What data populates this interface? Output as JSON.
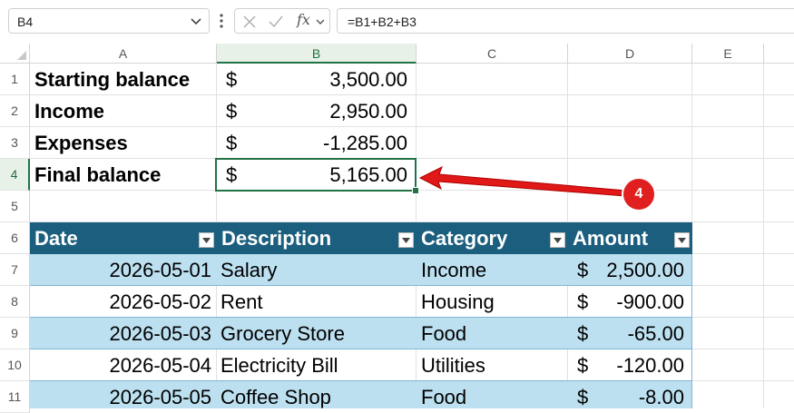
{
  "formula_bar": {
    "name_box": "B4",
    "formula": "=B1+B2+B3",
    "icons": [
      "chevron-down-icon",
      "more-vertical-icon",
      "cancel-icon",
      "enter-check-icon",
      "insert-function-icon",
      "expand-chevron-icon"
    ]
  },
  "columns": [
    "A",
    "B",
    "C",
    "D",
    "E"
  ],
  "rows": [
    "1",
    "2",
    "3",
    "4",
    "5",
    "6",
    "7",
    "8",
    "9",
    "10",
    "11"
  ],
  "summary": [
    {
      "label": "Starting balance",
      "currency": "$",
      "value": "3,500.00"
    },
    {
      "label": "Income",
      "currency": "$",
      "value": "2,950.00"
    },
    {
      "label": "Expenses",
      "currency": "$",
      "value": "-1,285.00"
    },
    {
      "label": "Final balance",
      "currency": "$",
      "value": "5,165.00"
    }
  ],
  "table": {
    "headers": [
      "Date",
      "Description",
      "Category",
      "Amount"
    ],
    "rows": [
      {
        "date": "2026-05-01",
        "description": "Salary",
        "category": "Income",
        "currency": "$",
        "amount": "2,500.00"
      },
      {
        "date": "2026-05-02",
        "description": "Rent",
        "category": "Housing",
        "currency": "$",
        "amount": "-900.00"
      },
      {
        "date": "2026-05-03",
        "description": "Grocery Store",
        "category": "Food",
        "currency": "$",
        "amount": "-65.00"
      },
      {
        "date": "2026-05-04",
        "description": "Electricity Bill",
        "category": "Utilities",
        "currency": "$",
        "amount": "-120.00"
      },
      {
        "date": "2026-05-05",
        "description": "Coffee Shop",
        "category": "Food",
        "currency": "$",
        "amount": "-8.00"
      }
    ]
  },
  "selected_cell": "B4",
  "callout": {
    "number": "4",
    "color": "#e02020"
  },
  "colors": {
    "accent": "#217346",
    "table_header": "#1b5e7e",
    "table_band": "#bde0f1"
  }
}
